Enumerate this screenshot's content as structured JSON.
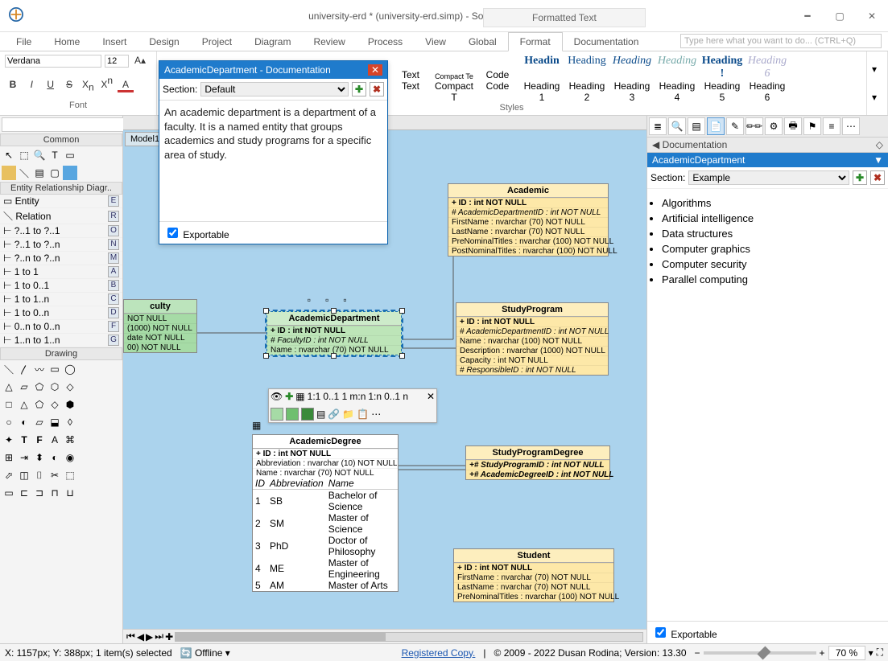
{
  "title": "university-erd * (university-erd.simp) - Software Ideas Modeler Ultimate",
  "secondary_tab": "Formatted Text",
  "menu": [
    "File",
    "Home",
    "Insert",
    "Design",
    "Project",
    "Diagram",
    "Review",
    "Process",
    "View",
    "Global",
    "Format",
    "Documentation"
  ],
  "menu_active": "Format",
  "searchbox": "Type here what you want to do...  (CTRL+Q)",
  "font": {
    "group": "Font",
    "family": "Verdana",
    "size": "12"
  },
  "styles_group": "Styles",
  "text_cells": [
    "Text",
    "Compact T",
    "Code"
  ],
  "text_previews": [
    "Text",
    "Compact Te",
    "Code"
  ],
  "headings": [
    "Heading 1",
    "Heading 2",
    "Heading 3",
    "Heading 4",
    "Heading 5",
    "Heading 6"
  ],
  "heading_preview": "Headin",
  "left": {
    "common": "Common",
    "erd_header": "Entity Relationship Diagr..",
    "items": [
      {
        "label": "Entity",
        "key": "E"
      },
      {
        "label": "Relation",
        "key": "R"
      },
      {
        "label": "?..1 to ?..1",
        "key": "O"
      },
      {
        "label": "?..1 to ?..n",
        "key": "N"
      },
      {
        "label": "?..n to ?..n",
        "key": "M"
      },
      {
        "label": "1 to 1",
        "key": "A"
      },
      {
        "label": "1 to 0..1",
        "key": "B"
      },
      {
        "label": "1 to 1..n",
        "key": "C"
      },
      {
        "label": "1 to 0..n",
        "key": "D"
      },
      {
        "label": "0..n to 0..n",
        "key": "F"
      },
      {
        "label": "1..n to 1..n",
        "key": "G"
      }
    ],
    "drawing": "Drawing"
  },
  "canvas_tab": "Model1",
  "doc_editor": {
    "title": "AcademicDepartment - Documentation",
    "section_label": "Section:",
    "section_value": "Default",
    "body": "An academic department is a department of a faculty. It is a named entity that groups academics and study programs for a specific area of study.",
    "exportable": "Exportable"
  },
  "doc_panel": {
    "header": "Documentation",
    "entity": "AcademicDepartment",
    "section_label": "Section:",
    "section_value": "Example",
    "items": [
      "Algorithms",
      "Artificial intelligence",
      "Data structures",
      "Computer graphics",
      "Computer security",
      "Parallel computing"
    ],
    "exportable": "Exportable"
  },
  "entities": {
    "faculty": {
      "name": "culty",
      "r1": "NOT NULL",
      "r2": "(1000)  NOT NULL",
      "r3": "date NOT NULL",
      "r4": "00)  NOT NULL"
    },
    "dept": {
      "name": "AcademicDepartment",
      "pk": "+ ID : int NOT NULL",
      "r1": "# FacultyID : int NOT NULL",
      "r2": "Name : nvarchar (70)  NOT NULL"
    },
    "academic": {
      "name": "Academic",
      "pk": "+ ID : int NOT NULL",
      "r1": "# AcademicDepartmentID : int NOT NULL",
      "r2": "FirstName : nvarchar (70)  NOT NULL",
      "r3": "LastName : nvarchar (70)  NOT NULL",
      "r4": "PreNominalTitles : nvarchar (100)  NOT NULL",
      "r5": "PostNominalTitles : nvarchar (100)  NOT NULL"
    },
    "program": {
      "name": "StudyProgram",
      "pk": "+ ID : int NOT NULL",
      "r1": "# AcademicDepartmentID : int NOT NULL",
      "r2": "Name : nvarchar (100)  NOT NULL",
      "r3": "Description : nvarchar (1000)  NOT NULL",
      "r4": "Capacity : int NOT NULL",
      "r5": "# ResponsibleID : int NOT NULL"
    },
    "spd": {
      "name": "StudyProgramDegree",
      "r1": "+# StudyProgramID : int NOT NULL",
      "r2": "+# AcademicDegreeID : int NOT NULL"
    },
    "degree": {
      "name": "AcademicDegree",
      "pk": "+ ID : int NOT NULL",
      "r1": "Abbreviation : nvarchar (10)  NOT NULL",
      "r2": "Name : nvarchar (70)  NOT NULL",
      "th": [
        "ID",
        "Abbreviation",
        "Name"
      ],
      "rows": [
        [
          "1",
          "SB",
          "Bachelor of Science"
        ],
        [
          "2",
          "SM",
          "Master of Science"
        ],
        [
          "3",
          "PhD",
          "Doctor of Philosophy"
        ],
        [
          "4",
          "ME",
          "Master of Engineering"
        ],
        [
          "5",
          "AM",
          "Master of Arts"
        ]
      ]
    },
    "student": {
      "name": "Student",
      "pk": "+ ID : int NOT NULL",
      "r1": "FirstName : nvarchar (70)  NOT NULL",
      "r2": "LastName : nvarchar (70)  NOT NULL",
      "r3": "PreNominalTitles : nvarchar (100)  NOT NULL"
    }
  },
  "mini": [
    "1:1",
    "0..1 1",
    "m:n",
    "1:n",
    "0..1 n"
  ],
  "status": {
    "pos": "X: 1157px; Y: 388px; 1 item(s) selected",
    "offline": "Offline",
    "reg": "Registered Copy.",
    "copy": "© 2009 - 2022 Dusan Rodina; Version: 13.30",
    "zoom": "70 %"
  }
}
